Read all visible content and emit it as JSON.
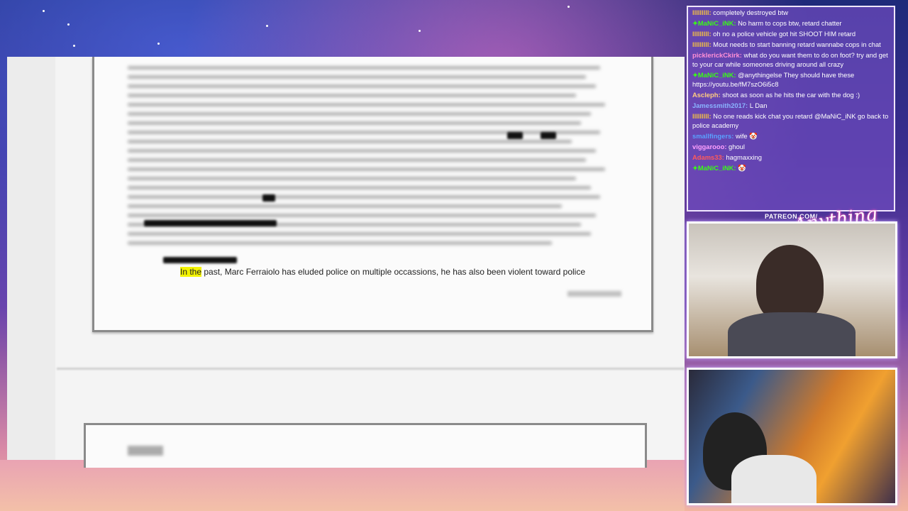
{
  "document": {
    "highlight": "In the",
    "text": " past, Marc Ferraiolo has eluded police on multiple occassions, he has also been violent toward police"
  },
  "overlay": {
    "patreon_label": "PATREON.COM/",
    "logo_text": "Anything Else"
  },
  "chat": {
    "messages": [
      {
        "user": "lllllllll:",
        "text": " completely destroyed btw",
        "color": "#f5c242"
      },
      {
        "user": "✦MaNiC_iNK:",
        "text": " No harm to cops btw, retard chatter",
        "color": "#39ff14"
      },
      {
        "user": "lllllllll:",
        "text": " oh no a police vehicle got hit SHOOT HIM retard",
        "color": "#f5c242"
      },
      {
        "user": "lllllllll:",
        "text": " Mout needs to start banning retard wannabe cops in chat",
        "color": "#f5c242"
      },
      {
        "user": "picklerickCkirk:",
        "text": " what do you want them to do on foot? try and get to your car while someones driving around all crazy",
        "color": "#ff8fd6"
      },
      {
        "user": "✦MaNiC_iNK:",
        "text": " @anythingelse They should have these https://youtu.be/fM7szO6i5c8",
        "color": "#39ff14"
      },
      {
        "user": "Ascleph:",
        "text": " shoot as soon as he hits the car with the dog :)",
        "color": "#ffcc80"
      },
      {
        "user": "Jamessmith2017:",
        "text": " L Dan",
        "color": "#8ab4ff"
      },
      {
        "user": "lllllllll:",
        "text": " No one reads kick chat you retard @MaNiC_iNK go back to police academy",
        "color": "#f5c242"
      },
      {
        "user": "smallfingers:",
        "text": " wife 🤡",
        "color": "#5aa0ff"
      },
      {
        "user": "viggarooo:",
        "text": " ghoul",
        "color": "#ffa0ff"
      },
      {
        "user": "Adams33:",
        "text": " hagmaxxing",
        "color": "#ff5a5a"
      },
      {
        "user": "✦MaNiC_iNK:",
        "text": " 🤡",
        "color": "#39ff14"
      }
    ]
  }
}
